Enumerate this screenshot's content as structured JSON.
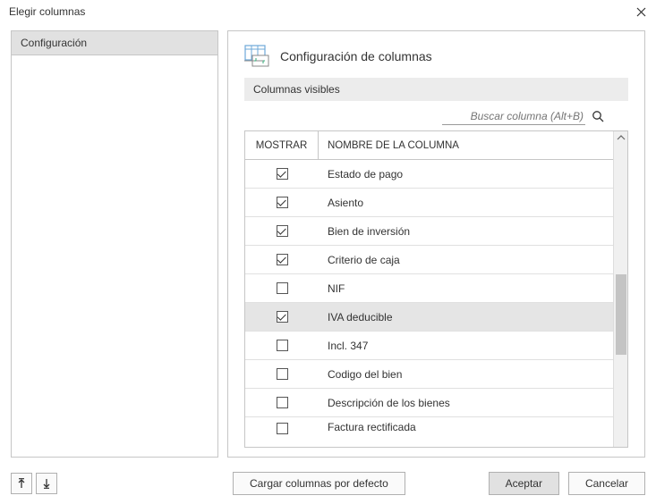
{
  "window": {
    "title": "Elegir columnas"
  },
  "sidebar": {
    "items": [
      {
        "label": "Configuración"
      }
    ]
  },
  "main": {
    "title": "Configuración de columnas",
    "subheader": "Columnas visibles"
  },
  "search": {
    "placeholder": "Buscar columna (Alt+B)"
  },
  "table": {
    "header_show": "MOSTRAR",
    "header_name": "NOMBRE DE LA COLUMNA",
    "rows": [
      {
        "checked": true,
        "label": "Estado de pago",
        "highlight": false
      },
      {
        "checked": true,
        "label": "Asiento",
        "highlight": false
      },
      {
        "checked": true,
        "label": "Bien de inversión",
        "highlight": false
      },
      {
        "checked": true,
        "label": "Criterio de caja",
        "highlight": false
      },
      {
        "checked": false,
        "label": "NIF",
        "highlight": false
      },
      {
        "checked": true,
        "label": "IVA deducible",
        "highlight": true
      },
      {
        "checked": false,
        "label": "Incl. 347",
        "highlight": false
      },
      {
        "checked": false,
        "label": "Codigo del bien",
        "highlight": false
      },
      {
        "checked": false,
        "label": "Descripción de los bienes",
        "highlight": false
      },
      {
        "checked": false,
        "label": "Factura rectificada",
        "highlight": false
      }
    ]
  },
  "footer": {
    "load_defaults": "Cargar columnas por defecto",
    "accept": "Aceptar",
    "cancel": "Cancelar"
  }
}
